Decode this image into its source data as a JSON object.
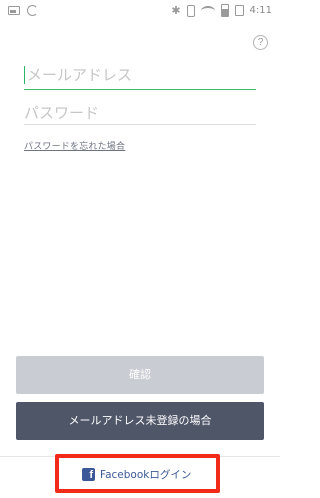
{
  "status_bar": {
    "time": "4:11",
    "icons": [
      "image-icon",
      "sync-icon",
      "bluetooth-icon",
      "vibrate-icon",
      "wifi-icon",
      "battery-saver-icon",
      "sim-icon"
    ]
  },
  "help": {
    "label": "?"
  },
  "login_form": {
    "email_placeholder": "メールアドレス",
    "password_placeholder": "パスワード",
    "forgot_password": "パスワードを忘れた場合"
  },
  "buttons": {
    "confirm": "確認",
    "unregistered": "メールアドレス未登録の場合"
  },
  "facebook": {
    "icon_letter": "f",
    "label": "Facebookログイン"
  },
  "colors": {
    "accent_green": "#3cba71",
    "confirm_disabled": "#c9ccd2",
    "dark_button": "#4f5668",
    "facebook_blue": "#3b5998",
    "highlight_red": "#f12a1a"
  }
}
